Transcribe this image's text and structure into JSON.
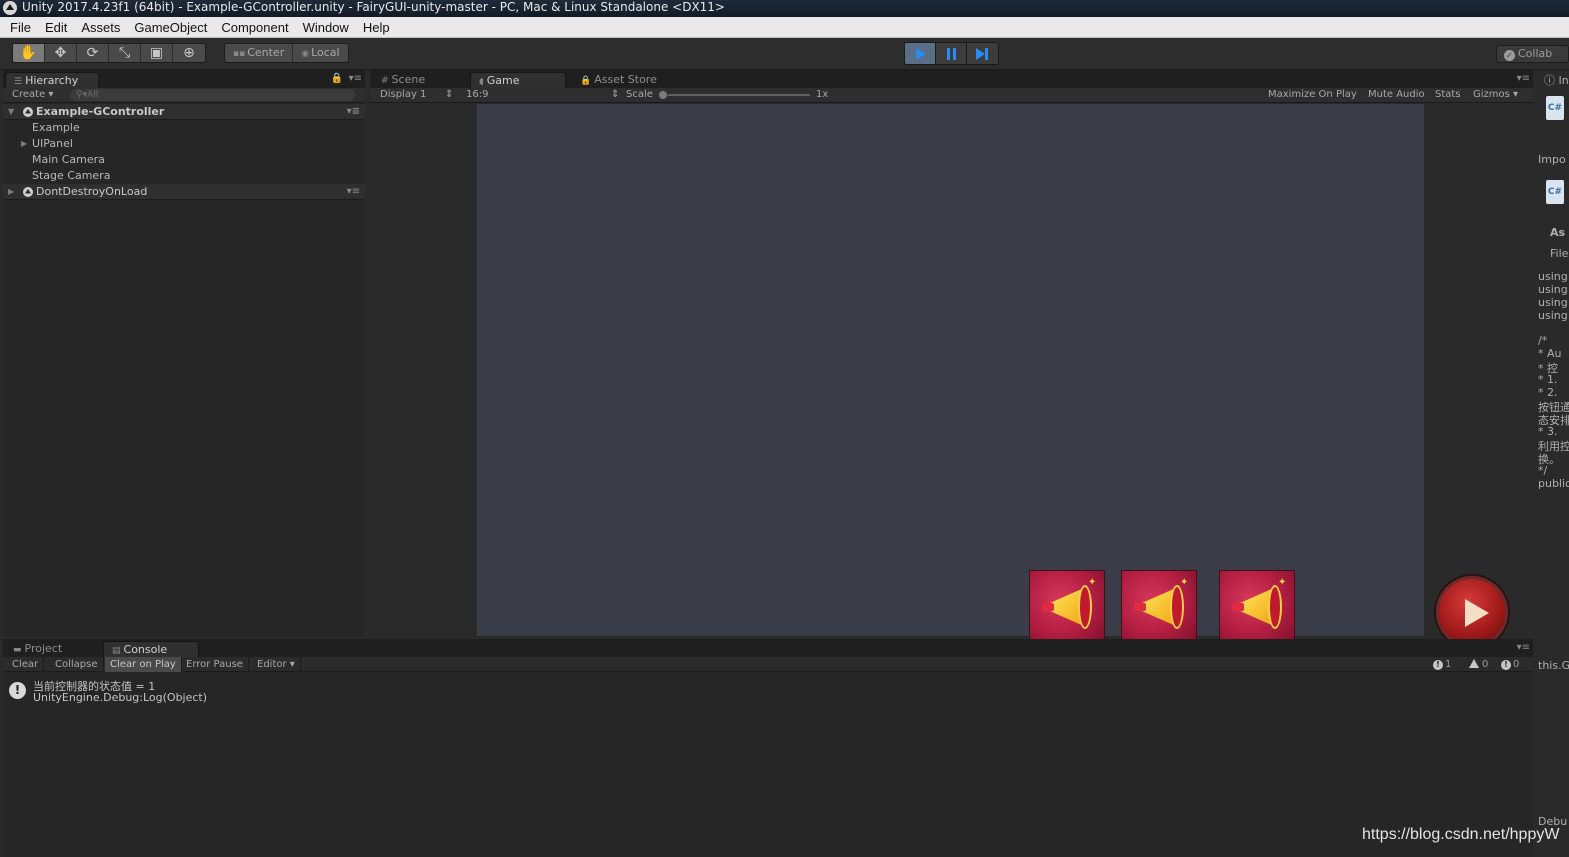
{
  "window": {
    "title": "Unity 2017.4.23f1 (64bit) - Example-GController.unity - FairyGUI-unity-master - PC, Mac & Linux Standalone <DX11>"
  },
  "menu": [
    "File",
    "Edit",
    "Assets",
    "GameObject",
    "Component",
    "Window",
    "Help"
  ],
  "toolbar": {
    "tools": [
      {
        "name": "hand-tool",
        "glyph": "✋"
      },
      {
        "name": "move-tool",
        "glyph": "✥"
      },
      {
        "name": "rotate-tool",
        "glyph": "⟳"
      },
      {
        "name": "scale-tool",
        "glyph": "⤡"
      },
      {
        "name": "rect-tool",
        "glyph": "▣"
      },
      {
        "name": "transform-tool",
        "glyph": "⊕"
      }
    ],
    "pivot_label": "Center",
    "space_label": "Local",
    "collab_label": "Collab"
  },
  "hierarchy": {
    "tab_label": "Hierarchy",
    "create_label": "Create",
    "search_placeholder": "All",
    "scenes": [
      {
        "label": "Example-GController",
        "children": [
          "Example",
          "UIPanel",
          "Main Camera",
          "Stage Camera"
        ]
      },
      {
        "label": "DontDestroyOnLoad"
      }
    ]
  },
  "game": {
    "tabs": [
      "Scene",
      "Game",
      "Asset Store"
    ],
    "display": "Display 1",
    "aspect": "16:9",
    "scale_label": "Scale",
    "scale_value": "1x",
    "options": [
      "Maximize On Play",
      "Mute Audio",
      "Stats",
      "Gizmos"
    ]
  },
  "inspector": {
    "texts": [
      "In",
      "Impo",
      "As",
      "File",
      "using",
      "using",
      "using",
      "using",
      "/*",
      " * Au",
      " * 控",
      " * 1.",
      " * 2.",
      "按钮通",
      "态安排",
      " * 3.",
      "利用控",
      "换。",
      " */",
      "public",
      "this.G",
      "Debu"
    ]
  },
  "console": {
    "tabs": [
      "Project",
      "Console"
    ],
    "buttons": [
      "Clear",
      "Collapse",
      "Clear on Play",
      "Error Pause",
      "Editor"
    ],
    "counts": {
      "info": "1",
      "warnings": "0",
      "errors": "0"
    },
    "log": {
      "message": "当前控制器的状态值 = 1",
      "trace": "UnityEngine.Debug:Log(Object)"
    }
  },
  "watermark": "https://blog.csdn.net/hppyW"
}
